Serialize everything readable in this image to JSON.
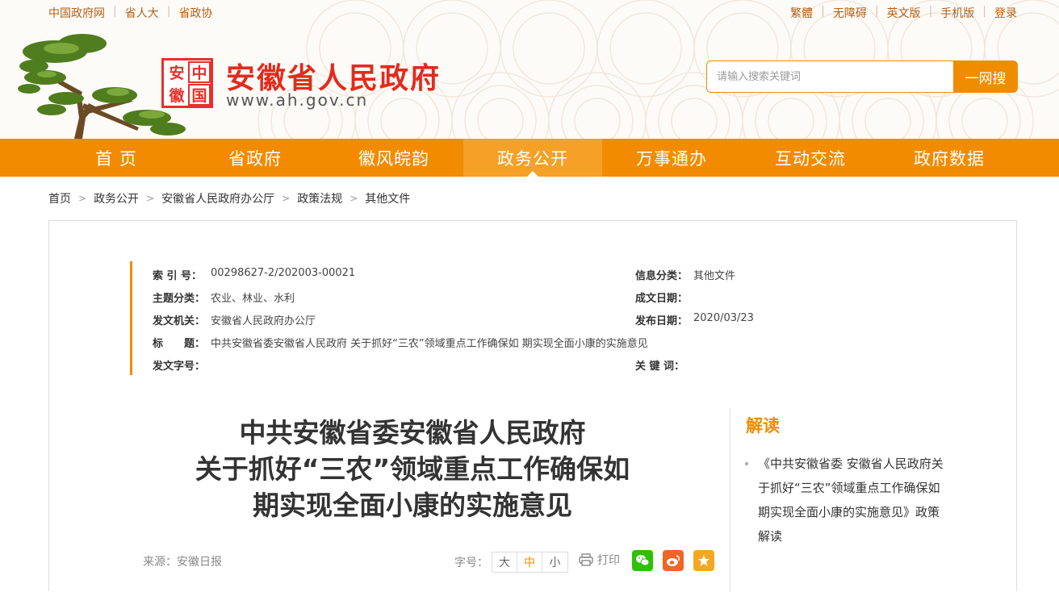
{
  "toplinks": {
    "left": [
      "中国政府网",
      "省人大",
      "省政协"
    ],
    "right": [
      "繁體",
      "无障碍",
      "英文版",
      "手机版",
      "登录"
    ]
  },
  "logo": {
    "seal_chars": [
      "安",
      "中",
      "徽",
      "国"
    ],
    "title": "安徽省人民政府",
    "url": "www.ah.gov.cn"
  },
  "search": {
    "placeholder": "请输入搜索关键词",
    "button": "一网搜"
  },
  "nav": {
    "items": [
      "首 页",
      "省政府",
      "徽风皖韵",
      "政务公开",
      "万事通办",
      "互动交流",
      "政府数据"
    ],
    "active_index": 3
  },
  "breadcrumb": [
    "首页",
    "政务公开",
    "安徽省人民政府办公厅",
    "政策法规",
    "其他文件"
  ],
  "meta": {
    "index_no_label": "索 引 号：",
    "index_no": "00298627-2/202003-00021",
    "category_label": "信息分类：",
    "category": "其他文件",
    "theme_label": "主题分类：",
    "theme": "农业、林业、水利",
    "written_date_label": "成文日期：",
    "written_date": "",
    "issuer_label": "发文机关：",
    "issuer": "安徽省人民政府办公厅",
    "publish_date_label": "发布日期：",
    "publish_date": "2020/03/23",
    "title_label": "标　　题：",
    "title": "中共安徽省委安徽省人民政府 关于抓好“三农”领域重点工作确保如 期实现全面小康的实施意见",
    "doc_no_label": "发文字号：",
    "doc_no": "",
    "keywords_label": "关 键 词：",
    "keywords": ""
  },
  "article": {
    "title_lines": [
      "中共安徽省委安徽省人民政府",
      "关于抓好“三农”领域重点工作确保如",
      "期实现全面小康的实施意见"
    ],
    "source": "来源：安徽日报",
    "fontsize_label": "字号：",
    "fontsize_options": [
      "大",
      "中",
      "小"
    ],
    "fontsize_selected": "中",
    "print_label": "打印"
  },
  "sidebar": {
    "title": "解读",
    "item": "《中共安徽省委 安徽省人民政府关于抓好“三农”领域重点工作确保如期实现全面小康的实施意见》政策解读"
  },
  "colors": {
    "accent": "#f08c00",
    "nav_bg": "#f38b00",
    "title_red": "#e22b1d",
    "wechat": "#2dc100",
    "weibo": "#f5a623",
    "favorite": "#f5a623"
  },
  "icons": [
    "tree-logo-icon",
    "print-icon",
    "wechat-icon",
    "weibo-icon",
    "star-icon"
  ]
}
